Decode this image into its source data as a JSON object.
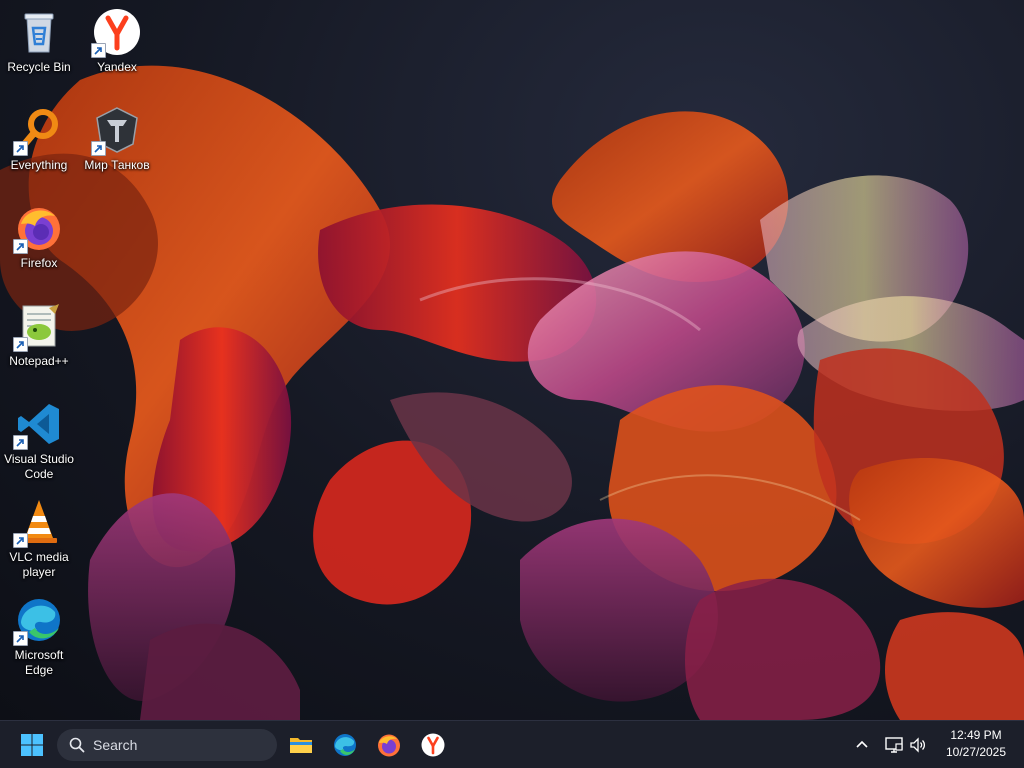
{
  "desktop": {
    "icons": [
      {
        "label": "Recycle Bin",
        "icon": "recycle-bin-icon"
      },
      {
        "label": "Yandex",
        "icon": "yandex-icon"
      },
      {
        "label": "Everything",
        "icon": "everything-search-icon"
      },
      {
        "label": "Мир Танков",
        "icon": "tank-game-icon"
      },
      {
        "label": "Firefox",
        "icon": "firefox-icon"
      },
      {
        "label": "Notepad++",
        "icon": "notepad-plus-plus-icon"
      },
      {
        "label": "Visual Studio Code",
        "icon": "vscode-icon"
      },
      {
        "label": "VLC media player",
        "icon": "vlc-icon"
      },
      {
        "label": "Microsoft Edge",
        "icon": "edge-icon"
      }
    ]
  },
  "taskbar": {
    "search_placeholder": "Search",
    "pinned": [
      "start-icon",
      "file-explorer-icon",
      "edge-icon",
      "firefox-icon",
      "yandex-icon"
    ],
    "tray": [
      "chevron-up-icon",
      "network-icon",
      "volume-icon"
    ],
    "clock": {
      "time": "12:49 PM",
      "date": "10/27/2025"
    }
  },
  "colors": {
    "taskbar_bg": "#1c1f2a",
    "search_bg": "#2d313d",
    "wallpaper_dark": "#141721",
    "ribbon_orange": "#e0521a",
    "ribbon_red": "#c41a2a",
    "ribbon_pink": "#e06cb0"
  }
}
